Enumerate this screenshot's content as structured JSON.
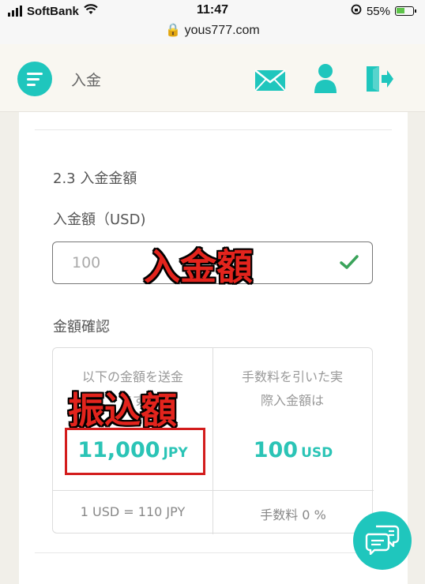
{
  "status_bar": {
    "carrier": "SoftBank",
    "time": "11:47",
    "url": "yous777.com",
    "battery": "55%"
  },
  "header": {
    "title": "入金"
  },
  "form": {
    "section_title": "2.3 入金金額",
    "amount_label": "入金額（USD)",
    "amount_value": "100",
    "confirm_label": "金額確認"
  },
  "confirm": {
    "left_head_line1": "以下の金額を送金",
    "left_head_line2": "ます",
    "left_value": "11,000",
    "left_unit": "JPY",
    "right_head_line1": "手数料を引いた実",
    "right_head_line2": "際入金額は",
    "right_value": "100",
    "right_unit": "USD",
    "rate": "1 USD = 110 JPY",
    "fee": "手数料 0 %"
  },
  "annotations": {
    "amount": "入金額",
    "transfer": "振込額"
  },
  "colors": {
    "accent": "#1fc6bd",
    "value": "#2bc4b6",
    "annotation": "#e3241d",
    "check": "#3aa35a"
  },
  "icons": [
    "menu-icon",
    "mail-icon",
    "user-icon",
    "logout-icon",
    "check-icon",
    "chat-icon",
    "lock-icon",
    "wifi-icon"
  ]
}
